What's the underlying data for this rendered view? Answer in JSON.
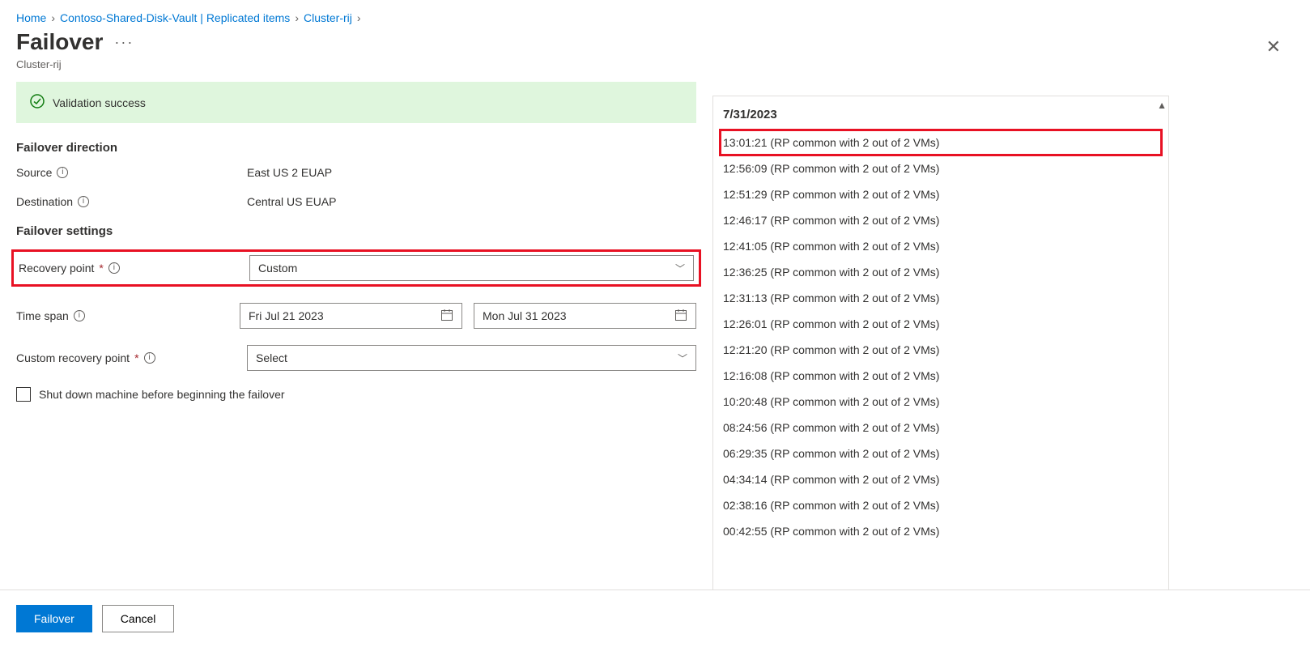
{
  "breadcrumb": {
    "items": [
      "Home",
      "Contoso-Shared-Disk-Vault | Replicated items",
      "Cluster-rij"
    ]
  },
  "header": {
    "title": "Failover",
    "subtitle": "Cluster-rij"
  },
  "validation": {
    "message": "Validation success"
  },
  "sections": {
    "direction_title": "Failover direction",
    "settings_title": "Failover settings"
  },
  "fields": {
    "source_label": "Source",
    "source_value": "East US 2 EUAP",
    "destination_label": "Destination",
    "destination_value": "Central US EUAP",
    "recovery_point_label": "Recovery point",
    "recovery_point_value": "Custom",
    "time_span_label": "Time span",
    "time_span_start": "Fri Jul 21 2023",
    "time_span_end": "Mon Jul 31 2023",
    "custom_rp_label": "Custom recovery point",
    "custom_rp_value": "Select",
    "shutdown_label": "Shut down machine before beginning the failover"
  },
  "rp_panel": {
    "date": "7/31/2023",
    "items": [
      "13:01:21 (RP common with 2 out of 2 VMs)",
      "12:56:09 (RP common with 2 out of 2 VMs)",
      "12:51:29 (RP common with 2 out of 2 VMs)",
      "12:46:17 (RP common with 2 out of 2 VMs)",
      "12:41:05 (RP common with 2 out of 2 VMs)",
      "12:36:25 (RP common with 2 out of 2 VMs)",
      "12:31:13 (RP common with 2 out of 2 VMs)",
      "12:26:01 (RP common with 2 out of 2 VMs)",
      "12:21:20 (RP common with 2 out of 2 VMs)",
      "12:16:08 (RP common with 2 out of 2 VMs)",
      "10:20:48 (RP common with 2 out of 2 VMs)",
      "08:24:56 (RP common with 2 out of 2 VMs)",
      "06:29:35 (RP common with 2 out of 2 VMs)",
      "04:34:14 (RP common with 2 out of 2 VMs)",
      "02:38:16 (RP common with 2 out of 2 VMs)",
      "00:42:55 (RP common with 2 out of 2 VMs)"
    ],
    "selected_index": 0
  },
  "footer": {
    "primary": "Failover",
    "secondary": "Cancel"
  }
}
